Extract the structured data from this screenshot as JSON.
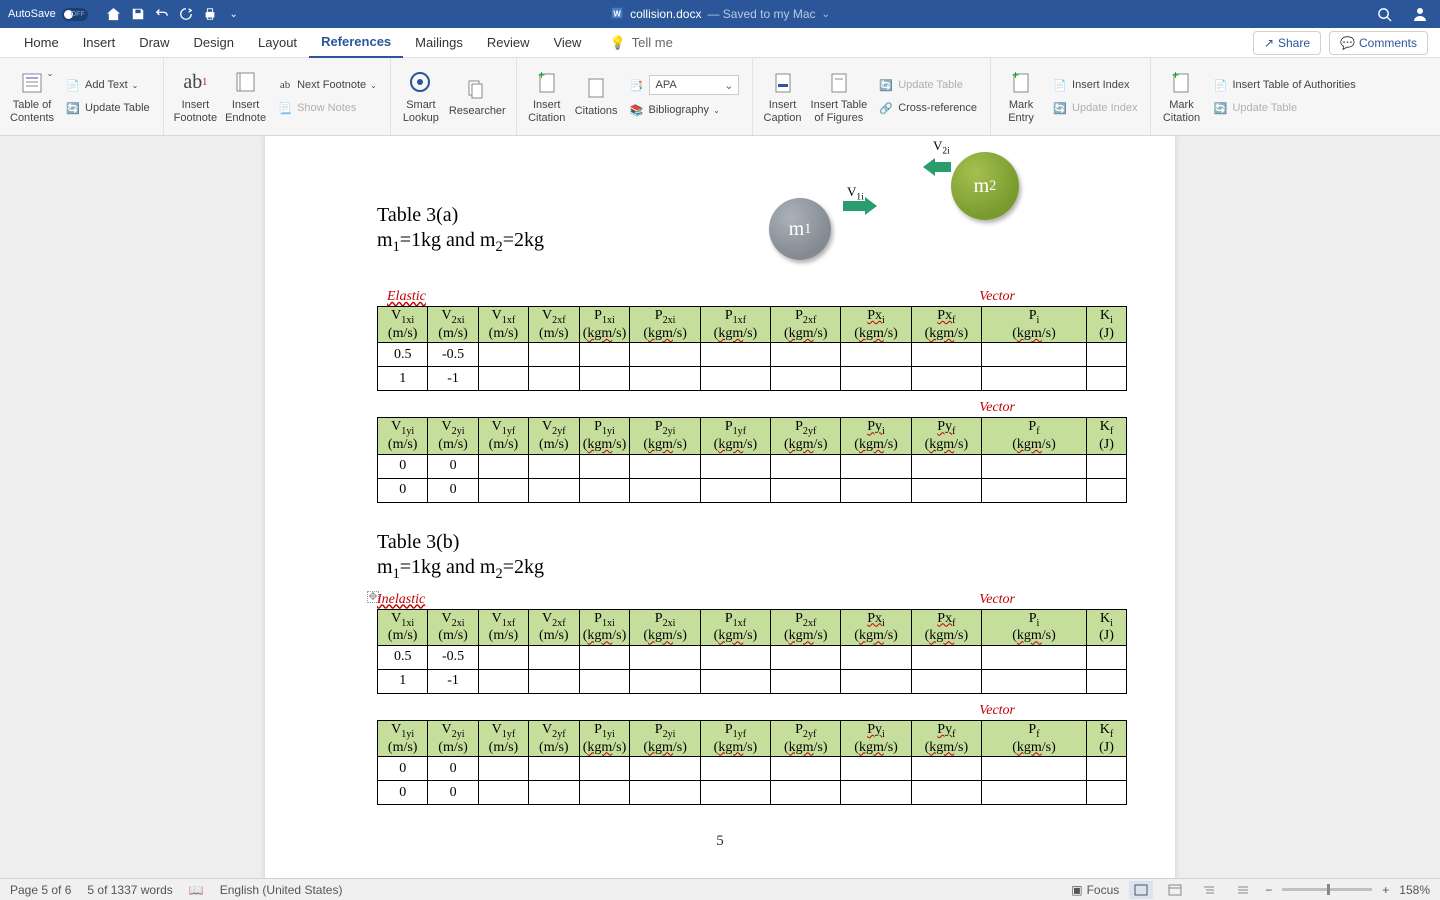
{
  "titlebar": {
    "autosave": "AutoSave",
    "toggle_state": "OFF",
    "filename": "collision.docx",
    "saved_to": "— Saved to my Mac"
  },
  "tabs": {
    "home": "Home",
    "insert": "Insert",
    "draw": "Draw",
    "design": "Design",
    "layout": "Layout",
    "references": "References",
    "mailings": "Mailings",
    "review": "Review",
    "view": "View",
    "tellme": "Tell me",
    "share": "Share",
    "comments": "Comments"
  },
  "ribbon": {
    "toc": "Table of\nContents",
    "addtext": "Add Text",
    "updatetable": "Update Table",
    "insertfootnote": "Insert\nFootnote",
    "insertendnote": "Insert\nEndnote",
    "nextfootnote": "Next Footnote",
    "shownotes": "Show Notes",
    "smartlookup": "Smart\nLookup",
    "researcher": "Researcher",
    "insertcitation": "Insert\nCitation",
    "citations": "Citations",
    "style_value": "APA",
    "bibliography": "Bibliography",
    "insertcaption": "Insert\nCaption",
    "inserttof": "Insert Table\nof Figures",
    "updatetable2": "Update Table",
    "crossref": "Cross-reference",
    "markentry": "Mark\nEntry",
    "insertindex": "Insert Index",
    "updateindex": "Update Index",
    "markcitation": "Mark\nCitation",
    "inserttoa": "Insert Table of Authorities",
    "updatetable3": "Update Table"
  },
  "doc": {
    "table3a_title": "Table 3(a)",
    "masses_line": "m₁=1kg and m₂=2kg",
    "table3b_title": "Table 3(b)",
    "label_elastic": "Elastic",
    "label_inelastic": "Inelastic",
    "label_vector": "Vector",
    "v1i_label": "V₁ᵢ",
    "v2i_label": "V₂ᵢ",
    "page_number": "5"
  },
  "status": {
    "page": "Page 5 of 6",
    "words": "5 of 1337 words",
    "lang": "English (United States)",
    "focus": "Focus",
    "zoom": "158%"
  },
  "chart_data": [
    {
      "type": "table",
      "name": "Table 3(a) Elastic x-direction",
      "masses": {
        "m1_kg": 1,
        "m2_kg": 2
      },
      "headers": [
        "V1xi (m/s)",
        "V2xi (m/s)",
        "V1xf (m/s)",
        "V2xf (m/s)",
        "P1xi (kgm/s)",
        "P2xi (kgm/s)",
        "P1xf (kgm/s)",
        "P2xf (kgm/s)",
        "Pxi (kgm/s)",
        "Pxf (kgm/s)",
        "Pi (kgm/s)",
        "Ki (J)"
      ],
      "rows": [
        [
          0.5,
          -0.5,
          null,
          null,
          null,
          null,
          null,
          null,
          null,
          null,
          null,
          null
        ],
        [
          1,
          -1,
          null,
          null,
          null,
          null,
          null,
          null,
          null,
          null,
          null,
          null
        ]
      ]
    },
    {
      "type": "table",
      "name": "Table 3(a) Elastic y-direction",
      "headers": [
        "V1yi (m/s)",
        "V2yi (m/s)",
        "V1yf (m/s)",
        "V2yf (m/s)",
        "P1yi (kgm/s)",
        "P2yi (kgm/s)",
        "P1yf (kgm/s)",
        "P2yf (kgm/s)",
        "Pyi (kgm/s)",
        "Pyf (kgm/s)",
        "Pf (kgm/s)",
        "Kf (J)"
      ],
      "rows": [
        [
          0,
          0,
          null,
          null,
          null,
          null,
          null,
          null,
          null,
          null,
          null,
          null
        ],
        [
          0,
          0,
          null,
          null,
          null,
          null,
          null,
          null,
          null,
          null,
          null,
          null
        ]
      ]
    },
    {
      "type": "table",
      "name": "Table 3(b) Inelastic x-direction",
      "masses": {
        "m1_kg": 1,
        "m2_kg": 2
      },
      "headers": [
        "V1xi (m/s)",
        "V2xi (m/s)",
        "V1xf (m/s)",
        "V2xf (m/s)",
        "P1xi (kgm/s)",
        "P2xi (kgm/s)",
        "P1xf (kgm/s)",
        "P2xf (kgm/s)",
        "Pxi (kgm/s)",
        "Pxf (kgm/s)",
        "Pi (kgm/s)",
        "Ki (J)"
      ],
      "rows": [
        [
          0.5,
          -0.5,
          null,
          null,
          null,
          null,
          null,
          null,
          null,
          null,
          null,
          null
        ],
        [
          1,
          -1,
          null,
          null,
          null,
          null,
          null,
          null,
          null,
          null,
          null,
          null
        ]
      ]
    },
    {
      "type": "table",
      "name": "Table 3(b) Inelastic y-direction",
      "headers": [
        "V1yi (m/s)",
        "V2yi (m/s)",
        "V1yf (m/s)",
        "V2yf (m/s)",
        "P1yi (kgm/s)",
        "P2yi (kgm/s)",
        "P1yf (kgm/s)",
        "P2yf (kgm/s)",
        "Pyi (kgm/s)",
        "Pyf (kgm/s)",
        "Pf (kgm/s)",
        "Kf (J)"
      ],
      "rows": [
        [
          0,
          0,
          null,
          null,
          null,
          null,
          null,
          null,
          null,
          null,
          null,
          null
        ],
        [
          0,
          0,
          null,
          null,
          null,
          null,
          null,
          null,
          null,
          null,
          null,
          null
        ]
      ]
    }
  ]
}
